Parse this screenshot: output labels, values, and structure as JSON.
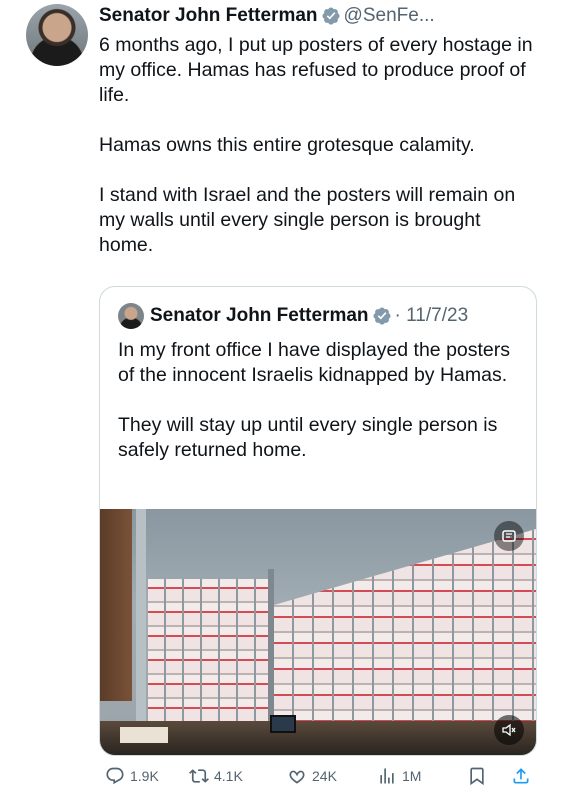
{
  "tweet": {
    "author_name": "Senator John Fetterman",
    "handle": "@SenFe...",
    "paragraphs": [
      "6 months ago, I put up posters of every hostage in my office. Hamas has refused to produce proof of life.",
      "Hamas owns this entire grotesque calamity.",
      "I stand with Israel and the posters will remain on my walls until every single person is brought home."
    ]
  },
  "quote": {
    "author_name": "Senator John Fetterman",
    "date": "· 11/7/23",
    "paragraphs": [
      "In my front office I have displayed the posters of the innocent Israelis kidnapped by Hamas.",
      "They will stay up until every single person is safely returned home."
    ],
    "gif_icon": "gif-icon",
    "mute_icon": "mute-icon"
  },
  "actions": {
    "replies": "1.9K",
    "reposts": "4.1K",
    "likes": "24K",
    "views": "1M"
  },
  "colors": {
    "text": "#0f1419",
    "secondary": "#536471",
    "verified": "#829aab",
    "border": "#cfd9de"
  }
}
